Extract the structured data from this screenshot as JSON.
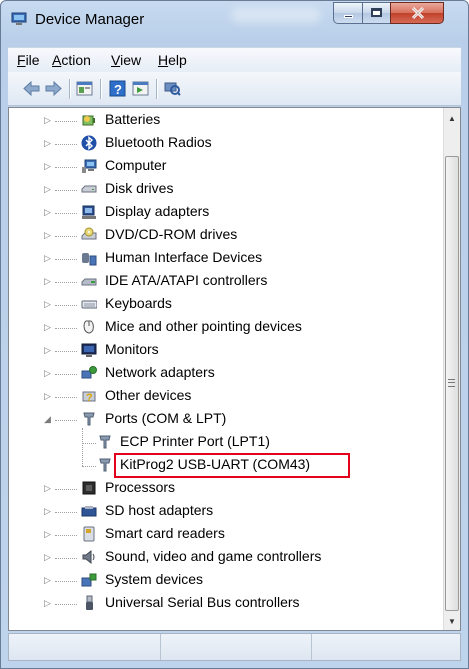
{
  "window": {
    "title": "Device Manager",
    "icon": "computer-icon",
    "controls": [
      {
        "name": "minimize-button",
        "glyph": "—"
      },
      {
        "name": "maximize-button",
        "glyph": "▢"
      },
      {
        "name": "close-button",
        "glyph": "✕"
      }
    ]
  },
  "menu": {
    "file": "File",
    "action": "Action",
    "view": "View",
    "help": "Help"
  },
  "toolbar": [
    "back-icon",
    "forward-icon",
    "properties-icon",
    "help-icon",
    "show-hidden-icon",
    "scan-hardware-icon"
  ],
  "tree": {
    "items": [
      {
        "label": "Batteries",
        "icon": "battery-icon",
        "expanded": false
      },
      {
        "label": "Bluetooth Radios",
        "icon": "bluetooth-icon",
        "expanded": false
      },
      {
        "label": "Computer",
        "icon": "computer-icon",
        "expanded": false
      },
      {
        "label": "Disk drives",
        "icon": "disk-drive-icon",
        "expanded": false
      },
      {
        "label": "Display adapters",
        "icon": "display-adapter-icon",
        "expanded": false
      },
      {
        "label": "DVD/CD-ROM drives",
        "icon": "dvd-drive-icon",
        "expanded": false
      },
      {
        "label": "Human Interface Devices",
        "icon": "hid-icon",
        "expanded": false
      },
      {
        "label": "IDE ATA/ATAPI controllers",
        "icon": "ide-controller-icon",
        "expanded": false
      },
      {
        "label": "Keyboards",
        "icon": "keyboard-icon",
        "expanded": false
      },
      {
        "label": "Mice and other pointing devices",
        "icon": "mouse-icon",
        "expanded": false
      },
      {
        "label": "Monitors",
        "icon": "monitor-icon",
        "expanded": false
      },
      {
        "label": "Network adapters",
        "icon": "network-adapter-icon",
        "expanded": false
      },
      {
        "label": "Other devices",
        "icon": "unknown-device-icon",
        "expanded": false
      },
      {
        "label": "Ports (COM & LPT)",
        "icon": "port-icon",
        "expanded": true
      },
      {
        "label": "ECP Printer Port (LPT1)",
        "icon": "port-icon",
        "child": true
      },
      {
        "label": "KitProg2 USB-UART (COM43)",
        "icon": "port-icon",
        "child": true,
        "highlighted": true
      },
      {
        "label": "Processors",
        "icon": "processor-icon",
        "expanded": false
      },
      {
        "label": "SD host adapters",
        "icon": "sd-adapter-icon",
        "expanded": false
      },
      {
        "label": "Smart card readers",
        "icon": "smart-card-icon",
        "expanded": false
      },
      {
        "label": "Sound, video and game controllers",
        "icon": "sound-icon",
        "expanded": false
      },
      {
        "label": "System devices",
        "icon": "system-device-icon",
        "expanded": false
      },
      {
        "label": "Universal Serial Bus controllers",
        "icon": "usb-icon",
        "expanded": false
      }
    ]
  },
  "colors": {
    "highlight_border": "#e3001b",
    "chrome": "#bed3ec"
  }
}
